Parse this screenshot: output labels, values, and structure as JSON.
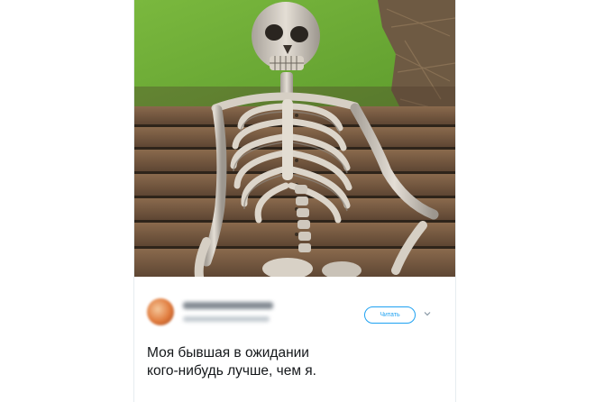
{
  "tweet": {
    "author_name": "",
    "author_handle": "",
    "follow_label": "Читать",
    "menu_icon": "chevron-down-icon",
    "text_lines": [
      "Моя бывшая в ожидании",
      "кого-нибудь лучше, чем я."
    ]
  },
  "media": {
    "subject": "skeleton-on-bench-photo"
  },
  "colors": {
    "accent": "#1da1f2",
    "text": "#14171a",
    "muted": "#8899a6",
    "border": "#e6ecf0"
  }
}
